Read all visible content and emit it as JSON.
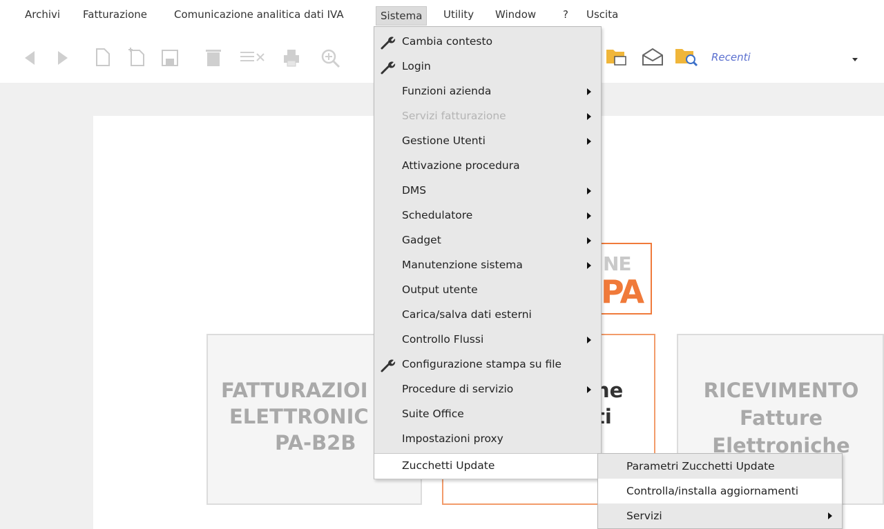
{
  "menubar": {
    "archivi": "Archivi",
    "fatturazione": "Fatturazione",
    "comunicazione": "Comunicazione analitica dati IVA",
    "sistema": "Sistema",
    "utility": "Utility",
    "window": "Window",
    "help": "?",
    "uscita": "Uscita"
  },
  "toolbar": {
    "recent_label": "Recenti",
    "icons": [
      "back-icon",
      "forward-icon",
      "new-document-icon",
      "new-copy-icon",
      "save-icon",
      "delete-icon",
      "remove-row-icon",
      "print-icon",
      "zoom-icon",
      "folder-icon",
      "mail-icon",
      "folder-search-icon",
      "dropdown-caret-icon"
    ]
  },
  "sistema_menu": {
    "items": [
      {
        "label": "Cambia contesto",
        "icon": "wrench-icon",
        "submenu": false,
        "disabled": false
      },
      {
        "label": "Login",
        "icon": "wrench-icon",
        "submenu": false,
        "disabled": false
      },
      {
        "label": "Funzioni azienda",
        "submenu": true,
        "disabled": false
      },
      {
        "label": "Servizi fatturazione",
        "submenu": true,
        "disabled": true
      },
      {
        "label": "Gestione Utenti",
        "submenu": true,
        "disabled": false
      },
      {
        "label": "Attivazione procedura",
        "submenu": false,
        "disabled": false
      },
      {
        "label": "DMS",
        "submenu": true,
        "disabled": false
      },
      {
        "label": "Schedulatore",
        "submenu": true,
        "disabled": false
      },
      {
        "label": "Gadget",
        "submenu": true,
        "disabled": false
      },
      {
        "label": "Manutenzione sistema",
        "submenu": true,
        "disabled": false
      },
      {
        "label": "Output utente",
        "submenu": false,
        "disabled": false
      },
      {
        "label": "Carica/salva dati esterni",
        "submenu": false,
        "disabled": false
      },
      {
        "label": "Controllo Flussi",
        "submenu": true,
        "disabled": false
      },
      {
        "label": "Configurazione stampa su file",
        "icon": "wrench-icon",
        "submenu": false,
        "disabled": false
      },
      {
        "label": "Procedure di servizio",
        "submenu": true,
        "disabled": false
      },
      {
        "label": "Suite Office",
        "submenu": false,
        "disabled": false
      },
      {
        "label": "Impostazioni proxy",
        "submenu": false,
        "disabled": false
      },
      {
        "label": "Zucchetti Update",
        "submenu": true,
        "disabled": false,
        "active": true
      }
    ]
  },
  "update_submenu": {
    "items": [
      {
        "label": "Parametri Zucchetti Update"
      },
      {
        "label": "Controlla/installa aggiornamenti",
        "hover": true
      },
      {
        "label": "Servizi",
        "submenu": true
      }
    ]
  },
  "cards": {
    "left": {
      "line1": "FATTURAZIOI",
      "line2": "ELETTRONIC",
      "line3": "PA-B2B"
    },
    "middle": {
      "line1": "ne",
      "line2": "ti"
    },
    "right": {
      "line1": "RICEVIMENTO",
      "line2": "Fatture",
      "line3": "Elettroniche"
    },
    "logo": {
      "top": "NE",
      "bottom": "PA"
    }
  }
}
